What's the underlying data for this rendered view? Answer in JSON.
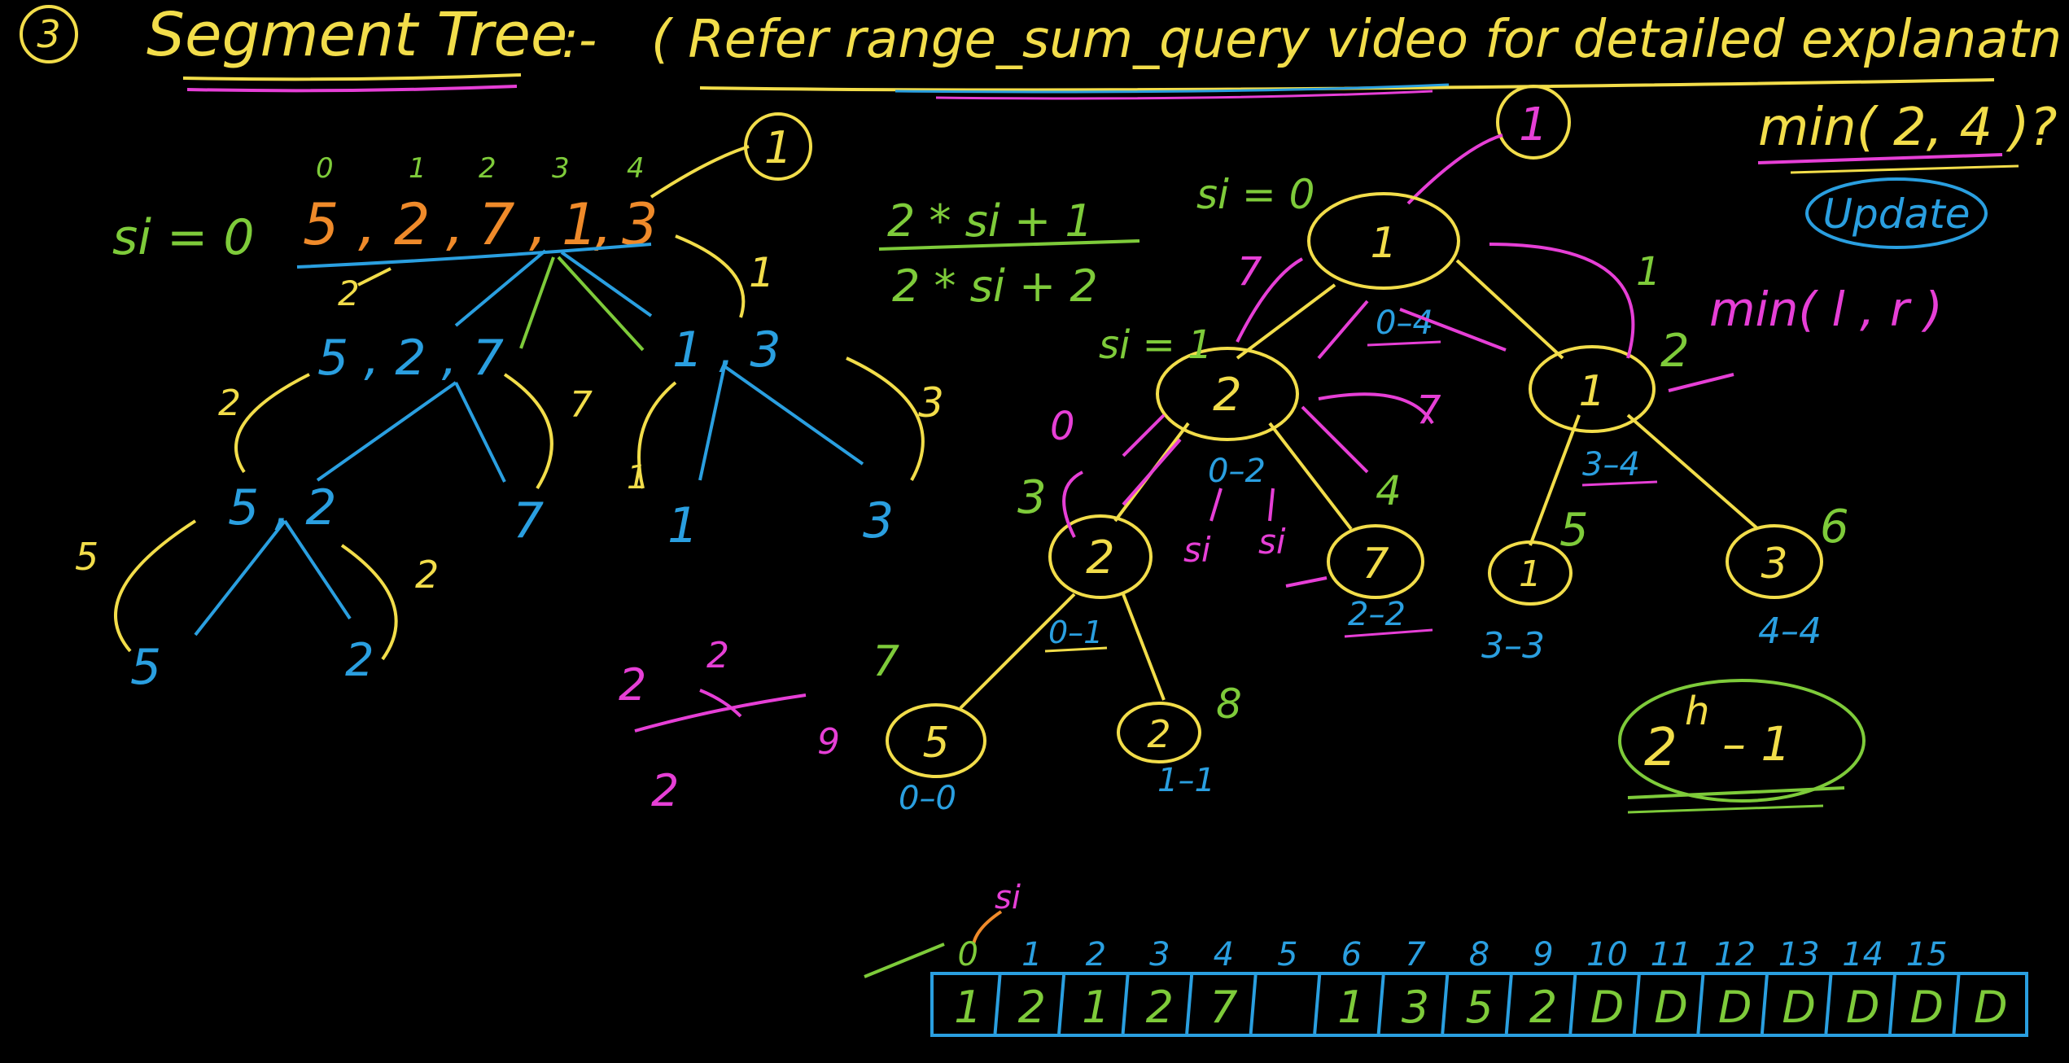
{
  "colors": {
    "yellow": "#f2dd4a",
    "green": "#7ecb3a",
    "pink": "#e63fd6",
    "blue": "#2a9fe0",
    "orange": "#ef8a2a",
    "background": "#000000"
  },
  "header": {
    "number": "3",
    "title": "Segment Tree",
    "separator": ":-",
    "note": "( Refer range_sum_query video for detailed explanatn )"
  },
  "array_top": {
    "indices": [
      "0",
      "1",
      "2",
      "3",
      "4"
    ],
    "si_label": "si = 0",
    "values": [
      "5",
      ",",
      "2",
      ",",
      "7",
      ",",
      "1",
      ",",
      "3"
    ],
    "root_result": "1",
    "arrow_value": "1"
  },
  "recursion_left": {
    "level1_left": "5 , 2 , 7",
    "level1_right": "1 , 3",
    "level2_left": "5 , 2",
    "level2_mid": "7",
    "level2_r_left": "1",
    "level2_r_right": "3",
    "level3_left": "5",
    "level3_right": "2",
    "returns": [
      "2",
      "7",
      "1",
      "3",
      "5",
      "2",
      "2",
      "1"
    ]
  },
  "formulas": {
    "left_child": "2 * si + 1",
    "right_child": "2 * si + 2"
  },
  "tree": {
    "si_root": "si = 0",
    "si_left": "si = 1",
    "top_circle": "1",
    "nodes": [
      {
        "value": "1",
        "range": ""
      },
      {
        "value": "2",
        "range": "0–2"
      },
      {
        "value": "1",
        "range": "3–4"
      },
      {
        "value": "2",
        "range": "0–1"
      },
      {
        "value": "7",
        "range": "2–2"
      },
      {
        "value": "1",
        "range": "3–3"
      },
      {
        "value": "3",
        "range": "4–4"
      },
      {
        "value": "5",
        "range": "0–0"
      },
      {
        "value": "2",
        "range": "1–1"
      }
    ],
    "root_range": "0–4",
    "index_labels": [
      "1",
      "2",
      "3",
      "4",
      "5",
      "6",
      "7",
      "8",
      "0"
    ],
    "edge_values": [
      "7",
      "7",
      "2"
    ],
    "si_marks": [
      "si",
      "si"
    ]
  },
  "side_notes": {
    "min_query": "min( 2, 4 )?",
    "update": "Update",
    "min_expr": "min( l , r )",
    "nodes_formula_base": "2",
    "nodes_formula_exp": "h",
    "nodes_formula_rest": "– 1",
    "pink_calc": [
      "2",
      "2",
      "2"
    ],
    "nine": "9"
  },
  "array_storage": {
    "si_label": "si",
    "indices": [
      "0",
      "1",
      "2",
      "3",
      "4",
      "5",
      "6",
      "7",
      "8",
      "9",
      "10",
      "11",
      "12",
      "13",
      "14",
      "15"
    ],
    "values": [
      "1",
      "2",
      "1",
      "2",
      "7",
      "",
      "1",
      "3",
      "5",
      "2",
      "D",
      "D",
      "D",
      "D",
      "D",
      "D",
      "D"
    ]
  }
}
